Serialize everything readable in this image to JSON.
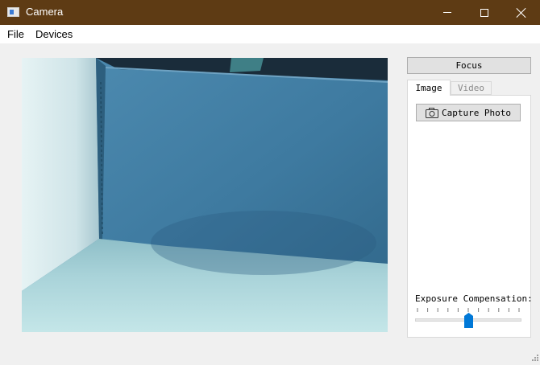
{
  "window": {
    "title": "Camera"
  },
  "menu": {
    "file": "File",
    "devices": "Devices"
  },
  "controls": {
    "focus_label": "Focus",
    "tabs": [
      {
        "label": "Image",
        "selected": true
      },
      {
        "label": "Video",
        "selected": false
      }
    ],
    "capture_label": "Capture Photo",
    "exposure_label": "Exposure Compensation:",
    "exposure_level": 0.5
  },
  "icons": {
    "app": "camera-app-icon",
    "capture": "camera-icon"
  },
  "colors": {
    "titlebar": "#5e3b14",
    "accent": "#0078d7"
  }
}
